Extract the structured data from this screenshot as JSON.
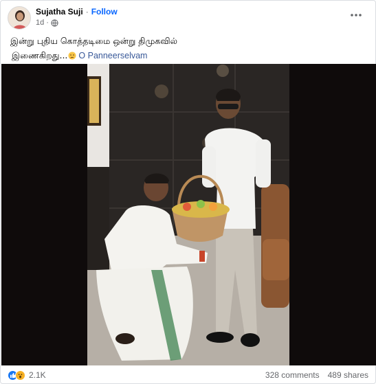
{
  "post": {
    "author": "Sujatha Suji",
    "separator": "·",
    "follow_label": "Follow",
    "time": "1d",
    "privacy_icon": "globe-icon",
    "more_icon": "more-options-icon",
    "text_line1": "இன்று புதிய கொத்தடிமை ஒன்று திமுகவில்",
    "text_line2": "இணைகிறது...",
    "emoji_icon": "thinking-face-icon",
    "tag": "O Panneerselvam"
  },
  "photo": {
    "description_icon": "photo-two-men-fruit-basket"
  },
  "footer": {
    "reaction_icons": [
      "like-icon",
      "wow-icon"
    ],
    "reaction_count": "2.1K",
    "comments": "328 comments",
    "shares": "489 shares"
  },
  "colors": {
    "accent": "#0866ff",
    "like": "#1877f2",
    "wow": "#f7b125",
    "secondary_text": "#65676b"
  }
}
